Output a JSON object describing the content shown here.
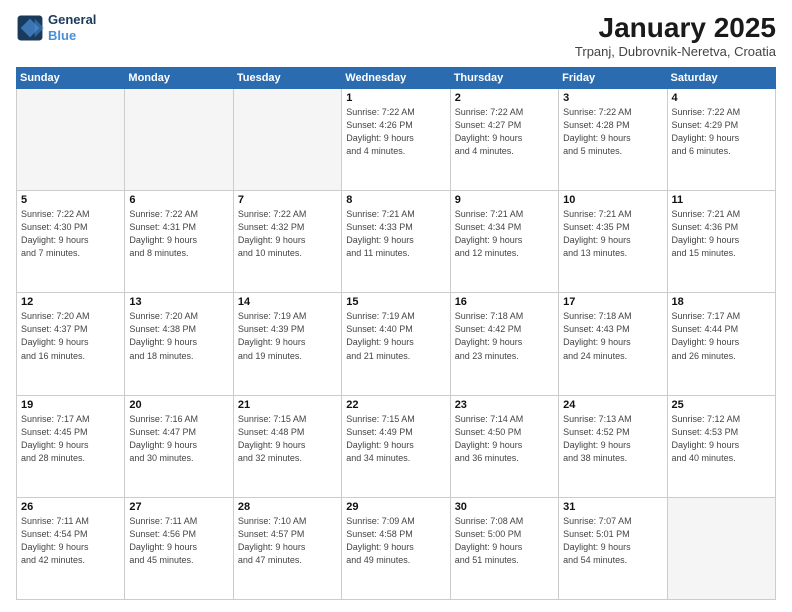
{
  "logo": {
    "line1": "General",
    "line2": "Blue"
  },
  "header": {
    "title": "January 2025",
    "subtitle": "Trpanj, Dubrovnik-Neretva, Croatia"
  },
  "weekdays": [
    "Sunday",
    "Monday",
    "Tuesday",
    "Wednesday",
    "Thursday",
    "Friday",
    "Saturday"
  ],
  "weeks": [
    [
      {
        "day": "",
        "info": ""
      },
      {
        "day": "",
        "info": ""
      },
      {
        "day": "",
        "info": ""
      },
      {
        "day": "1",
        "info": "Sunrise: 7:22 AM\nSunset: 4:26 PM\nDaylight: 9 hours\nand 4 minutes."
      },
      {
        "day": "2",
        "info": "Sunrise: 7:22 AM\nSunset: 4:27 PM\nDaylight: 9 hours\nand 4 minutes."
      },
      {
        "day": "3",
        "info": "Sunrise: 7:22 AM\nSunset: 4:28 PM\nDaylight: 9 hours\nand 5 minutes."
      },
      {
        "day": "4",
        "info": "Sunrise: 7:22 AM\nSunset: 4:29 PM\nDaylight: 9 hours\nand 6 minutes."
      }
    ],
    [
      {
        "day": "5",
        "info": "Sunrise: 7:22 AM\nSunset: 4:30 PM\nDaylight: 9 hours\nand 7 minutes."
      },
      {
        "day": "6",
        "info": "Sunrise: 7:22 AM\nSunset: 4:31 PM\nDaylight: 9 hours\nand 8 minutes."
      },
      {
        "day": "7",
        "info": "Sunrise: 7:22 AM\nSunset: 4:32 PM\nDaylight: 9 hours\nand 10 minutes."
      },
      {
        "day": "8",
        "info": "Sunrise: 7:21 AM\nSunset: 4:33 PM\nDaylight: 9 hours\nand 11 minutes."
      },
      {
        "day": "9",
        "info": "Sunrise: 7:21 AM\nSunset: 4:34 PM\nDaylight: 9 hours\nand 12 minutes."
      },
      {
        "day": "10",
        "info": "Sunrise: 7:21 AM\nSunset: 4:35 PM\nDaylight: 9 hours\nand 13 minutes."
      },
      {
        "day": "11",
        "info": "Sunrise: 7:21 AM\nSunset: 4:36 PM\nDaylight: 9 hours\nand 15 minutes."
      }
    ],
    [
      {
        "day": "12",
        "info": "Sunrise: 7:20 AM\nSunset: 4:37 PM\nDaylight: 9 hours\nand 16 minutes."
      },
      {
        "day": "13",
        "info": "Sunrise: 7:20 AM\nSunset: 4:38 PM\nDaylight: 9 hours\nand 18 minutes."
      },
      {
        "day": "14",
        "info": "Sunrise: 7:19 AM\nSunset: 4:39 PM\nDaylight: 9 hours\nand 19 minutes."
      },
      {
        "day": "15",
        "info": "Sunrise: 7:19 AM\nSunset: 4:40 PM\nDaylight: 9 hours\nand 21 minutes."
      },
      {
        "day": "16",
        "info": "Sunrise: 7:18 AM\nSunset: 4:42 PM\nDaylight: 9 hours\nand 23 minutes."
      },
      {
        "day": "17",
        "info": "Sunrise: 7:18 AM\nSunset: 4:43 PM\nDaylight: 9 hours\nand 24 minutes."
      },
      {
        "day": "18",
        "info": "Sunrise: 7:17 AM\nSunset: 4:44 PM\nDaylight: 9 hours\nand 26 minutes."
      }
    ],
    [
      {
        "day": "19",
        "info": "Sunrise: 7:17 AM\nSunset: 4:45 PM\nDaylight: 9 hours\nand 28 minutes."
      },
      {
        "day": "20",
        "info": "Sunrise: 7:16 AM\nSunset: 4:47 PM\nDaylight: 9 hours\nand 30 minutes."
      },
      {
        "day": "21",
        "info": "Sunrise: 7:15 AM\nSunset: 4:48 PM\nDaylight: 9 hours\nand 32 minutes."
      },
      {
        "day": "22",
        "info": "Sunrise: 7:15 AM\nSunset: 4:49 PM\nDaylight: 9 hours\nand 34 minutes."
      },
      {
        "day": "23",
        "info": "Sunrise: 7:14 AM\nSunset: 4:50 PM\nDaylight: 9 hours\nand 36 minutes."
      },
      {
        "day": "24",
        "info": "Sunrise: 7:13 AM\nSunset: 4:52 PM\nDaylight: 9 hours\nand 38 minutes."
      },
      {
        "day": "25",
        "info": "Sunrise: 7:12 AM\nSunset: 4:53 PM\nDaylight: 9 hours\nand 40 minutes."
      }
    ],
    [
      {
        "day": "26",
        "info": "Sunrise: 7:11 AM\nSunset: 4:54 PM\nDaylight: 9 hours\nand 42 minutes."
      },
      {
        "day": "27",
        "info": "Sunrise: 7:11 AM\nSunset: 4:56 PM\nDaylight: 9 hours\nand 45 minutes."
      },
      {
        "day": "28",
        "info": "Sunrise: 7:10 AM\nSunset: 4:57 PM\nDaylight: 9 hours\nand 47 minutes."
      },
      {
        "day": "29",
        "info": "Sunrise: 7:09 AM\nSunset: 4:58 PM\nDaylight: 9 hours\nand 49 minutes."
      },
      {
        "day": "30",
        "info": "Sunrise: 7:08 AM\nSunset: 5:00 PM\nDaylight: 9 hours\nand 51 minutes."
      },
      {
        "day": "31",
        "info": "Sunrise: 7:07 AM\nSunset: 5:01 PM\nDaylight: 9 hours\nand 54 minutes."
      },
      {
        "day": "",
        "info": ""
      }
    ]
  ]
}
